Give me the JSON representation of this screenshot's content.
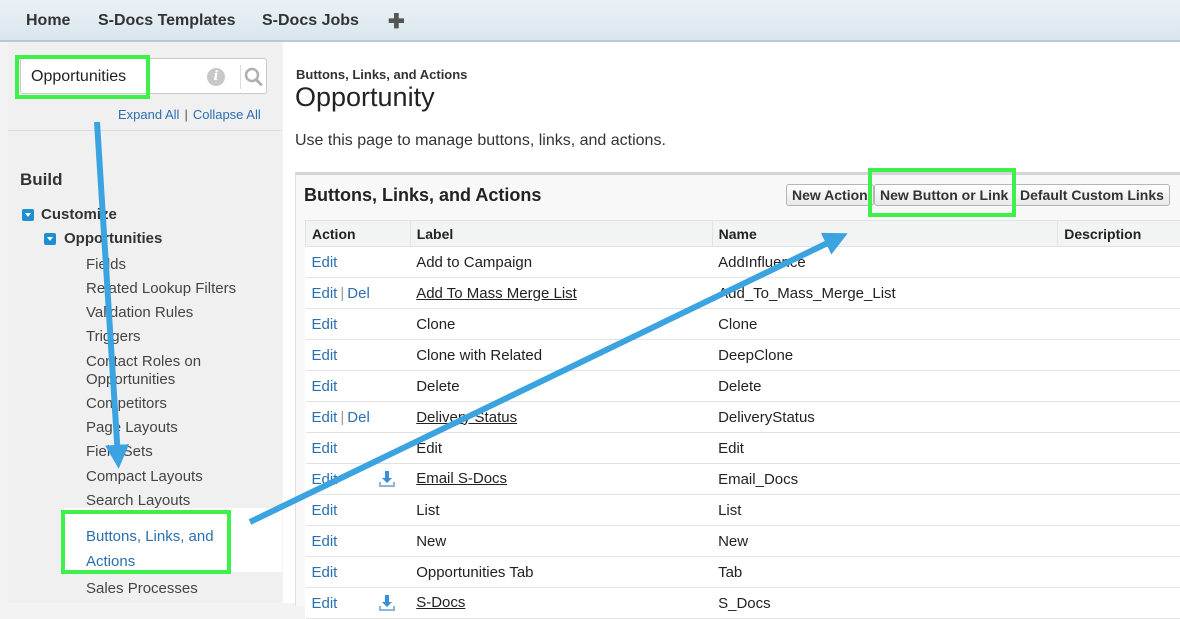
{
  "topnav": {
    "tabs": [
      "Home",
      "S-Docs Templates",
      "S-Docs Jobs"
    ],
    "plus": "✚"
  },
  "sidebar": {
    "search_value": "Opportunities",
    "expand_all": "Expand All",
    "collapse_all": "Collapse All",
    "separator": "|",
    "build": "Build",
    "customize": "Customize",
    "opportunities": "Opportunities",
    "items": [
      "Fields",
      "Related Lookup Filters",
      "Validation Rules",
      "Triggers",
      "Contact Roles on Opportunities",
      "Competitors",
      "Page Layouts",
      "Field Sets",
      "Compact Layouts",
      "Search Layouts",
      "Buttons, Links, and Actions",
      "Sales Processes"
    ]
  },
  "main": {
    "breadcrumb": "Buttons, Links, and Actions",
    "title": "Opportunity",
    "description": "Use this page to manage buttons, links, and actions.",
    "panel_title": "Buttons, Links, and Actions",
    "buttons": {
      "new_action": "New Action",
      "new_button": "New Button or Link",
      "default_links": "Default Custom Links"
    },
    "columns": [
      "Action",
      "Label",
      "Name",
      "Description"
    ],
    "edit": "Edit",
    "del": "Del",
    "rows": [
      {
        "label": "Add to Campaign",
        "name": "AddInfluence",
        "del": false,
        "link": false,
        "icon": false
      },
      {
        "label": "Add To Mass Merge List",
        "name": "Add_To_Mass_Merge_List",
        "del": true,
        "link": true,
        "icon": false
      },
      {
        "label": "Clone",
        "name": "Clone",
        "del": false,
        "link": false,
        "icon": false
      },
      {
        "label": "Clone with Related",
        "name": "DeepClone",
        "del": false,
        "link": false,
        "icon": false
      },
      {
        "label": "Delete",
        "name": "Delete",
        "del": false,
        "link": false,
        "icon": false
      },
      {
        "label": "Delivery Status",
        "name": "DeliveryStatus",
        "del": true,
        "link": true,
        "icon": false
      },
      {
        "label": "Edit",
        "name": "Edit",
        "del": false,
        "link": false,
        "icon": false
      },
      {
        "label": "Email S-Docs",
        "name": "Email_Docs",
        "del": false,
        "link": true,
        "icon": true
      },
      {
        "label": "List",
        "name": "List",
        "del": false,
        "link": false,
        "icon": false
      },
      {
        "label": "New",
        "name": "New",
        "del": false,
        "link": false,
        "icon": false
      },
      {
        "label": "Opportunities Tab",
        "name": "Tab",
        "del": false,
        "link": false,
        "icon": false
      },
      {
        "label": "S-Docs",
        "name": "S_Docs",
        "del": false,
        "link": true,
        "icon": true
      }
    ]
  },
  "colors": {
    "highlight": "#3ef04a",
    "arrow": "#3aa3e0",
    "link": "#2a6fb0",
    "tree": "#1e8fd0"
  }
}
